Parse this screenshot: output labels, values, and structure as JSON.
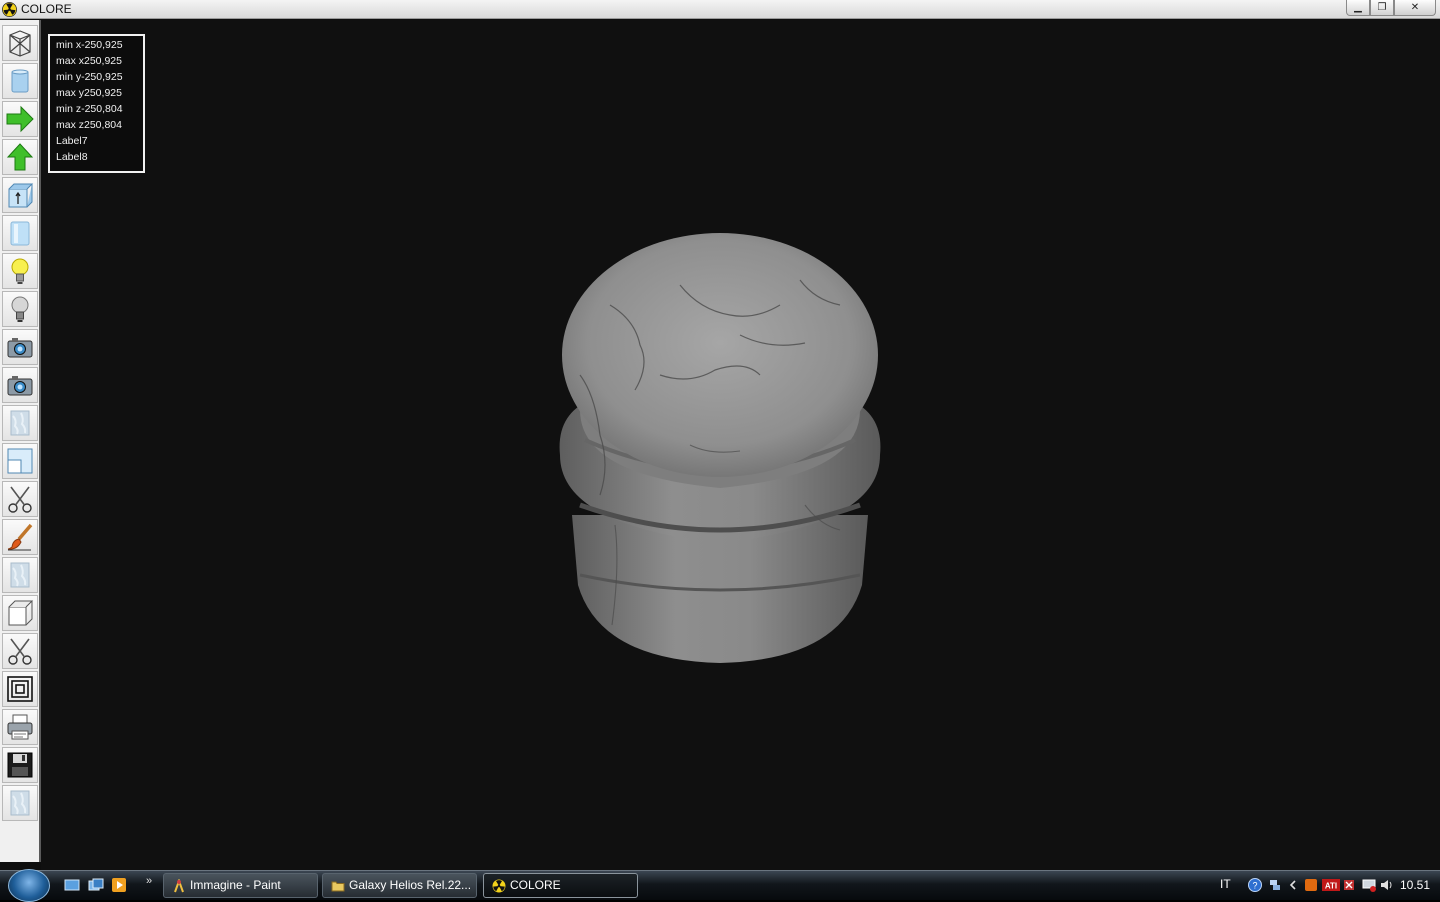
{
  "window": {
    "title": "COLORE"
  },
  "win_buttons": {
    "minimize": "▁",
    "restore": "❐",
    "close": "✕"
  },
  "toolbar": {
    "tools": [
      {
        "name": "wireframe-tool",
        "icon": "wireframe-icon"
      },
      {
        "name": "solid-tool",
        "icon": "cylinder-icon"
      },
      {
        "name": "rotate-right-tool",
        "icon": "green-arrow-right-icon"
      },
      {
        "name": "rotate-up-tool",
        "icon": "green-arrow-up-icon"
      },
      {
        "name": "front-view-tool",
        "icon": "box-front-icon"
      },
      {
        "name": "side-view-tool",
        "icon": "cylinder-light-icon"
      },
      {
        "name": "light-on-tool",
        "icon": "lightbulb-on-icon"
      },
      {
        "name": "light-off-tool",
        "icon": "lightbulb-off-icon"
      },
      {
        "name": "camera-tool-1",
        "icon": "camera-icon"
      },
      {
        "name": "camera-tool-2",
        "icon": "camera-icon"
      },
      {
        "name": "texture-tool-1",
        "icon": "texture-icon"
      },
      {
        "name": "panel-tool",
        "icon": "panel-icon"
      },
      {
        "name": "cut-tool-1",
        "icon": "scissors-icon"
      },
      {
        "name": "paint-tool",
        "icon": "brush-icon"
      },
      {
        "name": "texture-tool-2",
        "icon": "texture-icon"
      },
      {
        "name": "box-tool",
        "icon": "cube-icon"
      },
      {
        "name": "cut-tool-2",
        "icon": "scissors-icon"
      },
      {
        "name": "layers-tool",
        "icon": "concentric-squares-icon"
      },
      {
        "name": "print-tool",
        "icon": "printer-icon"
      },
      {
        "name": "save-tool",
        "icon": "floppy-disk-icon"
      },
      {
        "name": "texture-tool-3",
        "icon": "texture-icon"
      }
    ]
  },
  "info": {
    "min_x": "min x-250,925",
    "max_x": "max x250,925",
    "min_y": "min y-250,925",
    "max_y": "max y250,925",
    "min_z": "min z-250,804",
    "max_z": "max z250,804",
    "label7": "Label7",
    "label8": "Label8"
  },
  "taskbar": {
    "overflow": "»",
    "tasks": [
      {
        "label": "Immagine - Paint",
        "icon": "paint-icon"
      },
      {
        "label": "Galaxy Helios  Rel.22...",
        "icon": "folder-icon"
      },
      {
        "label": "COLORE",
        "icon": "radiation-icon"
      }
    ],
    "language": "IT",
    "clock": "10.51"
  },
  "colors": {
    "accent_green": "#3fbf2a",
    "background": "#101010",
    "marble": "#8a8a8a"
  }
}
